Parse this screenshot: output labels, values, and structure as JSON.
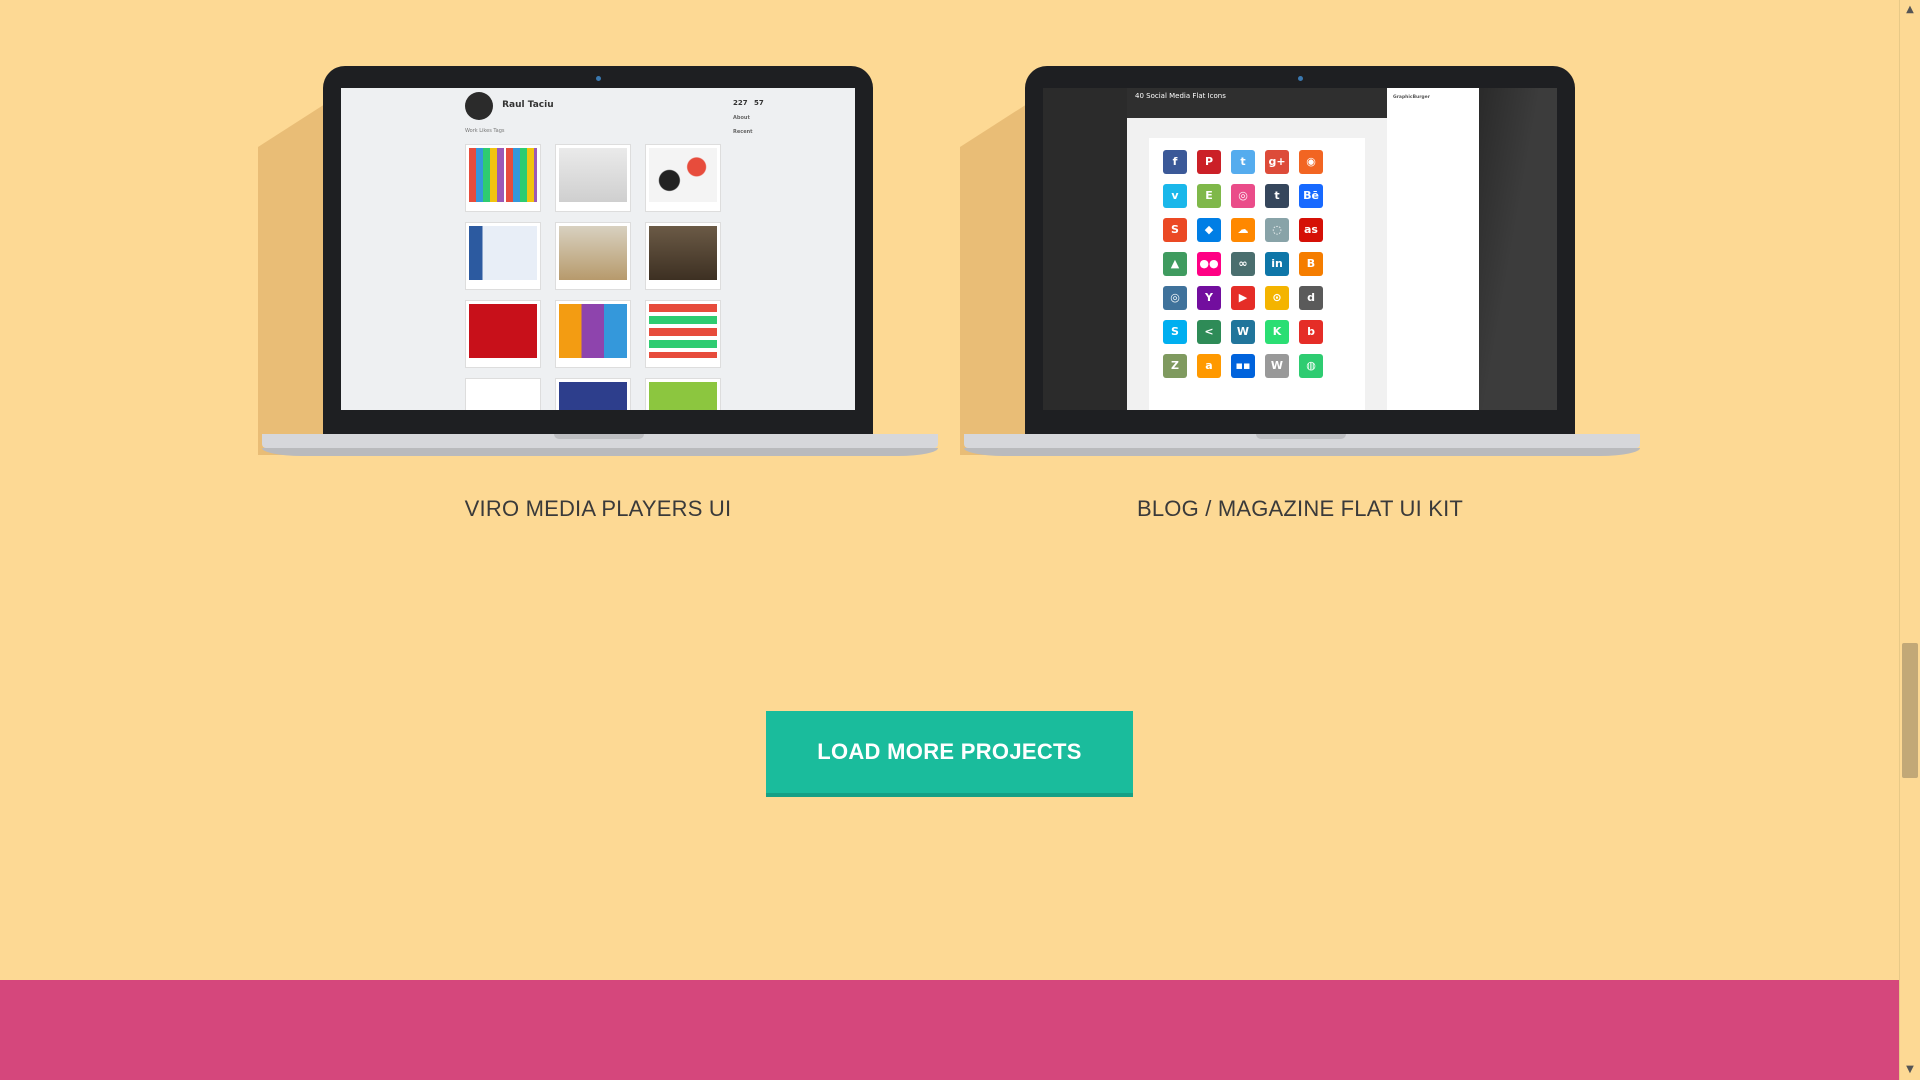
{
  "projects": [
    {
      "title": "VIRO MEDIA PLAYERS UI"
    },
    {
      "title": "BLOG / MAGAZINE FLAT UI KIT"
    }
  ],
  "screen1": {
    "name": "Raul Taciu",
    "tabs": "Work   Likes   Tags",
    "stats": [
      "227",
      "57"
    ],
    "about": "About",
    "recent": "Recent"
  },
  "screen2": {
    "title": "40 Social Media Flat Icons",
    "sidebar_name": "GraphicBurger"
  },
  "icons": [
    {
      "glyph": "f",
      "color": "#3b5998"
    },
    {
      "glyph": "P",
      "color": "#cb2027"
    },
    {
      "glyph": "t",
      "color": "#55acee"
    },
    {
      "glyph": "g+",
      "color": "#dd4b39"
    },
    {
      "glyph": "◉",
      "color": "#f26522"
    },
    {
      "glyph": "v",
      "color": "#1ab7ea"
    },
    {
      "glyph": "E",
      "color": "#7fb84a"
    },
    {
      "glyph": "◎",
      "color": "#ea4c89"
    },
    {
      "glyph": "t",
      "color": "#35465c"
    },
    {
      "glyph": "Bē",
      "color": "#1769ff"
    },
    {
      "glyph": "S",
      "color": "#eb4924"
    },
    {
      "glyph": "◆",
      "color": "#007ee5"
    },
    {
      "glyph": "☁",
      "color": "#ff8800"
    },
    {
      "glyph": "◌",
      "color": "#88a3a8"
    },
    {
      "glyph": "as",
      "color": "#d51007"
    },
    {
      "glyph": "▲",
      "color": "#3f9b5f"
    },
    {
      "glyph": "●●",
      "color": "#ff0084"
    },
    {
      "glyph": "∞",
      "color": "#4a6e6e"
    },
    {
      "glyph": "in",
      "color": "#0e76a8"
    },
    {
      "glyph": "B",
      "color": "#f57d00"
    },
    {
      "glyph": "◎",
      "color": "#3f729b"
    },
    {
      "glyph": "Y",
      "color": "#720e9e"
    },
    {
      "glyph": "▶",
      "color": "#e52d27"
    },
    {
      "glyph": "⊙",
      "color": "#f4b400"
    },
    {
      "glyph": "d",
      "color": "#5a5a5a"
    },
    {
      "glyph": "S",
      "color": "#00aff0"
    },
    {
      "glyph": "<",
      "color": "#2e8b57"
    },
    {
      "glyph": "W",
      "color": "#21759b"
    },
    {
      "glyph": "K",
      "color": "#2bde73"
    },
    {
      "glyph": "b",
      "color": "#e52d27"
    },
    {
      "glyph": "Z",
      "color": "#7f9a5f"
    },
    {
      "glyph": "a",
      "color": "#ff9900"
    },
    {
      "glyph": "▪▪",
      "color": "#0063dc"
    },
    {
      "glyph": "W",
      "color": "#999999"
    },
    {
      "glyph": "◍",
      "color": "#2ecc71"
    }
  ],
  "button": {
    "label": "LOAD MORE PROJECTS"
  },
  "colors": {
    "background": "#fdd994",
    "accent": "#1abc9c",
    "band": "#d5477c"
  },
  "scrollbar": {
    "up": "▲",
    "down": "▼"
  }
}
